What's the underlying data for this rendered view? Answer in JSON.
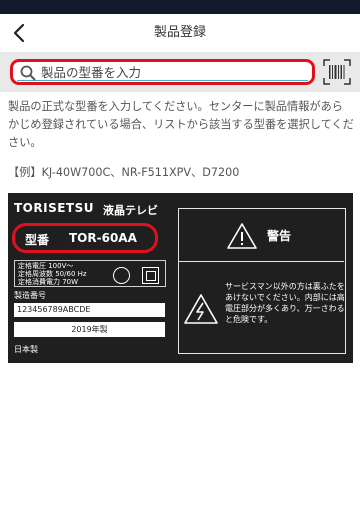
{
  "nav": {
    "title": "製品登録"
  },
  "search": {
    "placeholder": "製品の型番を入力",
    "value": ""
  },
  "description": "製品の正式な型番を入力してください。センターに製品情報があらかじめ登録されている場合、リストから該当する型番を選択してください。",
  "example": "【例】KJ-40W700C、NR-F511XPV、D7200",
  "label_card": {
    "brand": "TORISETSU",
    "product_type": "液晶テレビ",
    "model_label": "型番",
    "model_value": "TOR-60AA",
    "specs": [
      "定格電圧 100V〜",
      "定格周波数 50/60 Hz",
      "定格消費電力 70W"
    ],
    "serial_label": "製造番号",
    "serial_value": "123456789ABCDE",
    "year": "2019年製",
    "origin": "日本製",
    "warning_title": "警告",
    "warning_text": "サービスマン以外の方は裏ふたをあけないでください。内部には高電圧部分が多くあり、万一さわると危険です。"
  },
  "colors": {
    "highlight": "#e0101e",
    "underline": "#3bb6c9",
    "search_bg": "#e9e9e9",
    "label_bg": "#1f1f1f",
    "status_bar": "#12192b"
  },
  "icons": {
    "back": "chevron-left-icon",
    "search": "search-icon",
    "scan": "barcode-scan-icon",
    "warning": "warning-triangle-icon",
    "shock": "electric-shock-warning-icon"
  }
}
